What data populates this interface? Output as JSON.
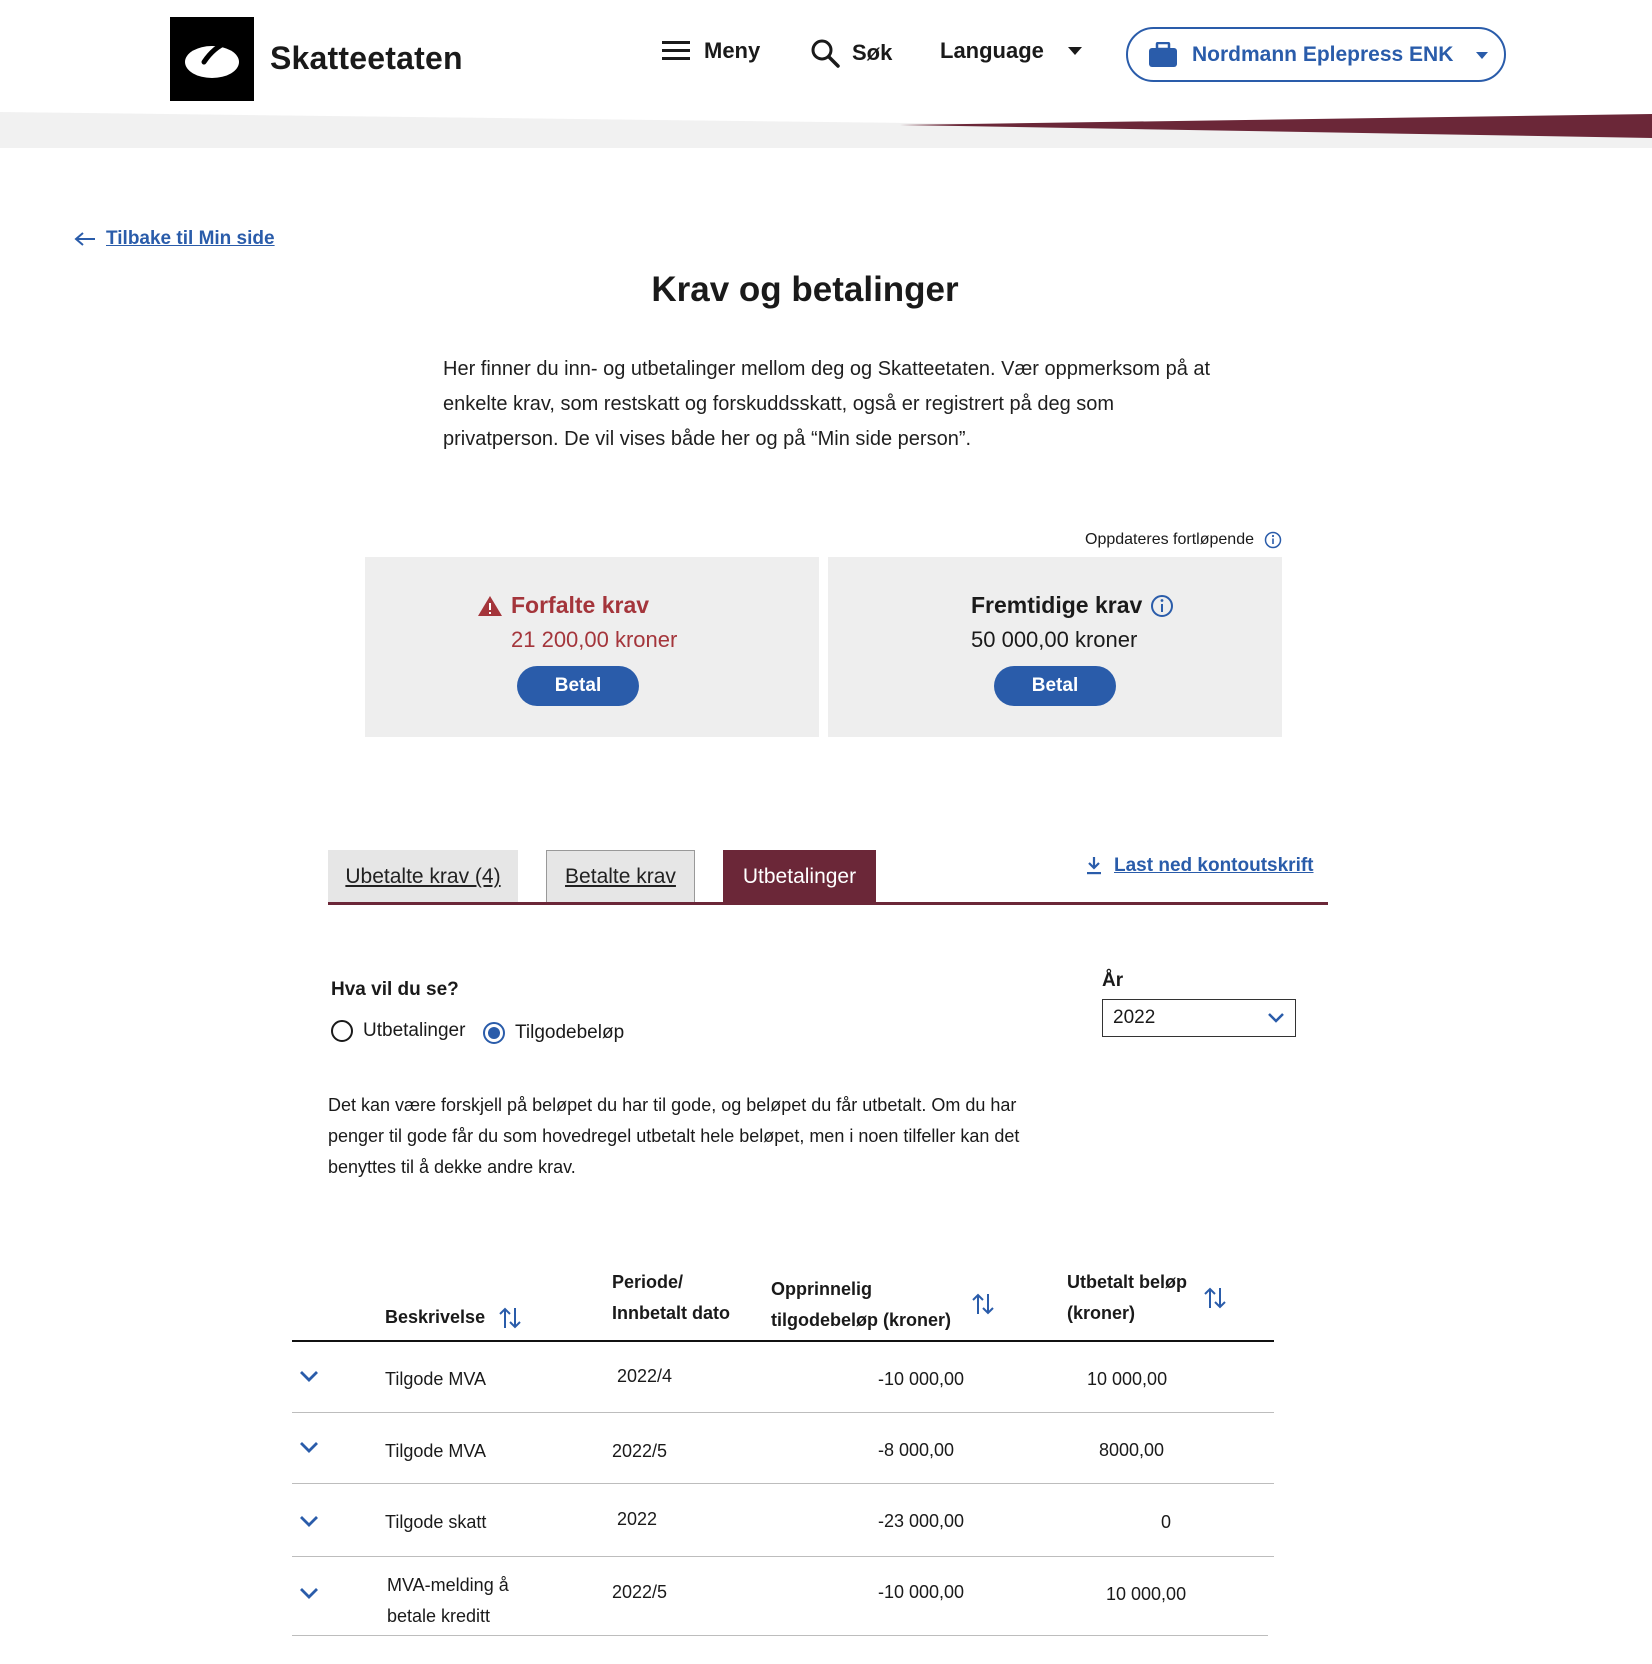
{
  "header": {
    "brand": "Skatteetaten",
    "menu_label": "Meny",
    "search_label": "Søk",
    "language_label": "Language",
    "org_name": "Nordmann Eplepress ENK"
  },
  "back_link": "Tilbake til Min side",
  "page_title": "Krav og betalinger",
  "intro_text": "Her finner du inn- og utbetalinger mellom deg og Skatteetaten. Vær oppmerksom på at enkelte krav, som restskatt og forskuddsskatt, også er registrert på deg som privatperson. De vil vises både her og på “Min side person”.",
  "updated_text": "Oppdateres fortløpende",
  "cards": {
    "overdue": {
      "title": "Forfalte krav",
      "amount": "21 200,00 kroner",
      "button": "Betal"
    },
    "future": {
      "title": "Fremtidige krav",
      "amount": "50 000,00 kroner",
      "button": "Betal"
    }
  },
  "tabs": [
    {
      "label": "Ubetalte krav (4)"
    },
    {
      "label": "Betalte krav"
    },
    {
      "label": "Utbetalinger"
    }
  ],
  "download_label": "Last ned kontoutskrift",
  "filter": {
    "question": "Hva vil du se?",
    "options": [
      "Utbetalinger",
      "Tilgodebeløp"
    ],
    "selected": "Tilgodebeløp",
    "year_label": "År",
    "year_value": "2022"
  },
  "note_text": "Det kan være forskjell på beløpet du har til gode, og beløpet du får utbetalt. Om du har penger til gode får du som hovedregel utbetalt hele beløpet, men i noen tilfeller kan det benyttes til å dekke andre krav.",
  "table": {
    "headers": {
      "description": "Beskrivelse",
      "period_line1": "Periode/",
      "period_line2": "Innbetalt dato",
      "original_line1": "Opprinnelig",
      "original_line2": "tilgodebeløp  (kroner)",
      "paid_line1": "Utbetalt beløp",
      "paid_line2": "(kroner)"
    },
    "rows": [
      {
        "description": "Tilgode MVA",
        "period": "2022/4",
        "original": "-10 000,00",
        "paid": "10 000,00"
      },
      {
        "description": "Tilgode MVA",
        "period": "2022/5",
        "original": "-8 000,00",
        "paid": "8000,00"
      },
      {
        "description": "Tilgode skatt",
        "period": "2022",
        "original": "-23 000,00",
        "paid": "0"
      },
      {
        "description_line1": "MVA-melding å",
        "description_line2": "betale kreditt",
        "period": "2022/5",
        "original": "-10 000,00",
        "paid": "10 000,00"
      }
    ]
  },
  "colors": {
    "brand_blue": "#2a5caa",
    "burgundy": "#6b2738",
    "warning_red": "#a4353b",
    "card_bg": "#eeeeee"
  }
}
